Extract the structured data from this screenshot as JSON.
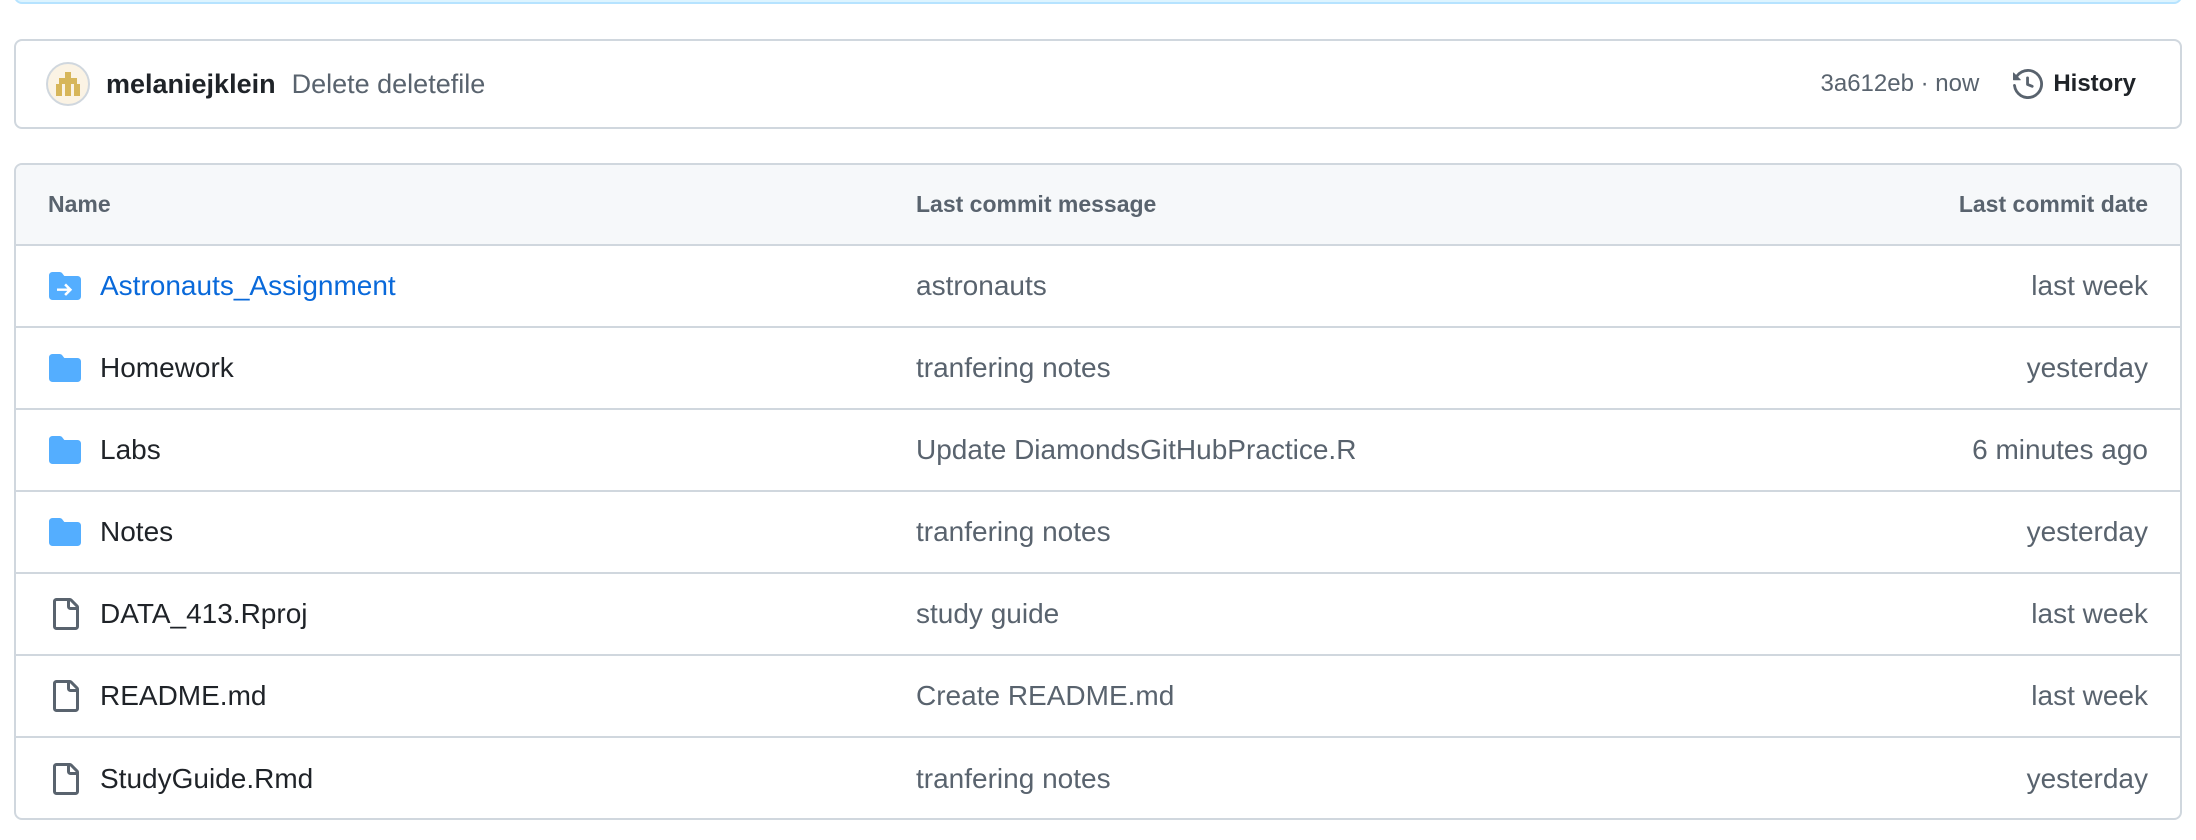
{
  "commit": {
    "author": "melaniejklein",
    "message": "Delete deletefile",
    "sha_time": "3a612eb · now",
    "history_label": "History"
  },
  "table": {
    "headers": {
      "name": "Name",
      "message": "Last commit message",
      "date": "Last commit date"
    },
    "rows": [
      {
        "name": "Astronauts_Assignment",
        "message": "astronauts",
        "date": "last week",
        "icon": "submodule-folder-icon"
      },
      {
        "name": "Homework",
        "message": "tranfering notes",
        "date": "yesterday",
        "icon": "folder-icon"
      },
      {
        "name": "Labs",
        "message": "Update DiamondsGitHubPractice.R",
        "date": "6 minutes ago",
        "icon": "folder-icon"
      },
      {
        "name": "Notes",
        "message": "tranfering notes",
        "date": "yesterday",
        "icon": "folder-icon"
      },
      {
        "name": "DATA_413.Rproj",
        "message": "study guide",
        "date": "last week",
        "icon": "file-icon"
      },
      {
        "name": "README.md",
        "message": "Create README.md",
        "date": "last week",
        "icon": "file-icon"
      },
      {
        "name": "StudyGuide.Rmd",
        "message": "tranfering notes",
        "date": "yesterday",
        "icon": "file-icon"
      }
    ]
  },
  "colors": {
    "link": "#0969da",
    "folder": "#54aeff",
    "muted": "#59636e",
    "border": "#d0d7de"
  }
}
